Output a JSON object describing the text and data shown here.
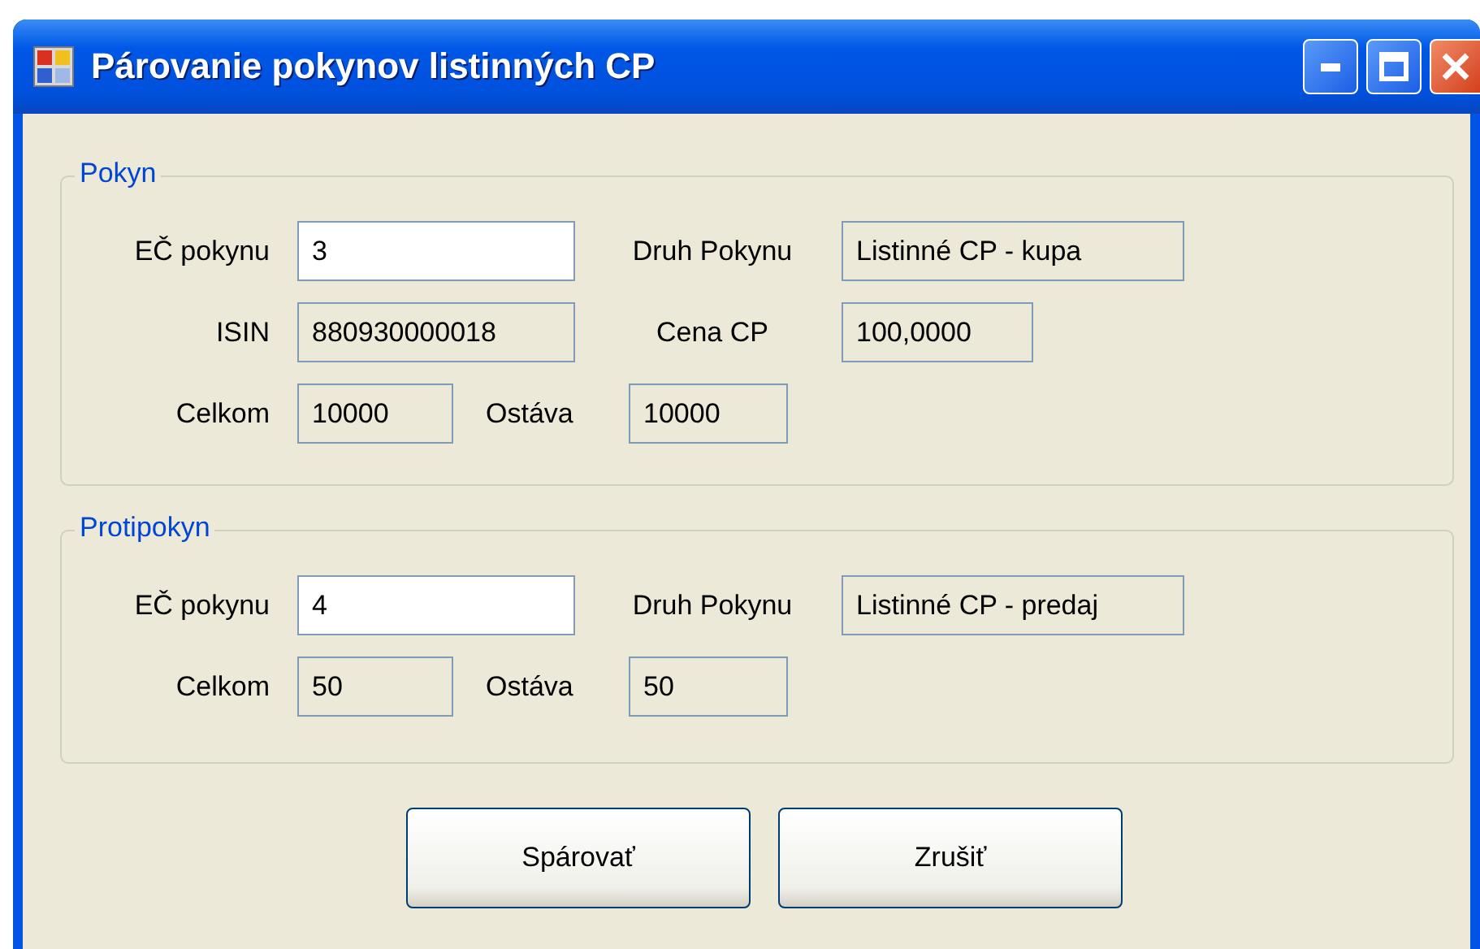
{
  "window": {
    "title": "Párovanie pokynov listinných CP"
  },
  "groups": [
    {
      "title": "Pokyn",
      "lines": [
        {
          "kind": "pair",
          "fields": [
            {
              "label": "EČ pokynu",
              "value": "3",
              "editable": true
            },
            {
              "label": "Druh Pokynu",
              "value": "Listinné CP - kupa",
              "editable": false
            }
          ]
        },
        {
          "kind": "pair",
          "fields": [
            {
              "label": "ISIN",
              "value": "880930000018",
              "editable": false
            },
            {
              "label": "Cena CP",
              "value": "100,0000",
              "editable": false
            }
          ]
        },
        {
          "kind": "totals",
          "fields": [
            {
              "label": "Celkom",
              "value": "10000",
              "editable": false
            },
            {
              "label": "Ostáva",
              "value": "10000",
              "editable": false
            }
          ]
        }
      ]
    },
    {
      "title": "Protipokyn",
      "lines": [
        {
          "kind": "pair",
          "fields": [
            {
              "label": "EČ pokynu",
              "value": "4",
              "editable": true
            },
            {
              "label": "Druh Pokynu",
              "value": "Listinné CP - predaj",
              "editable": false
            }
          ]
        },
        {
          "kind": "totals",
          "fields": [
            {
              "label": "Celkom",
              "value": "50",
              "editable": false
            },
            {
              "label": "Ostáva",
              "value": "50",
              "editable": false
            }
          ]
        }
      ]
    }
  ],
  "buttons": [
    {
      "label": "Spárovať"
    },
    {
      "label": "Zrušiť"
    }
  ]
}
